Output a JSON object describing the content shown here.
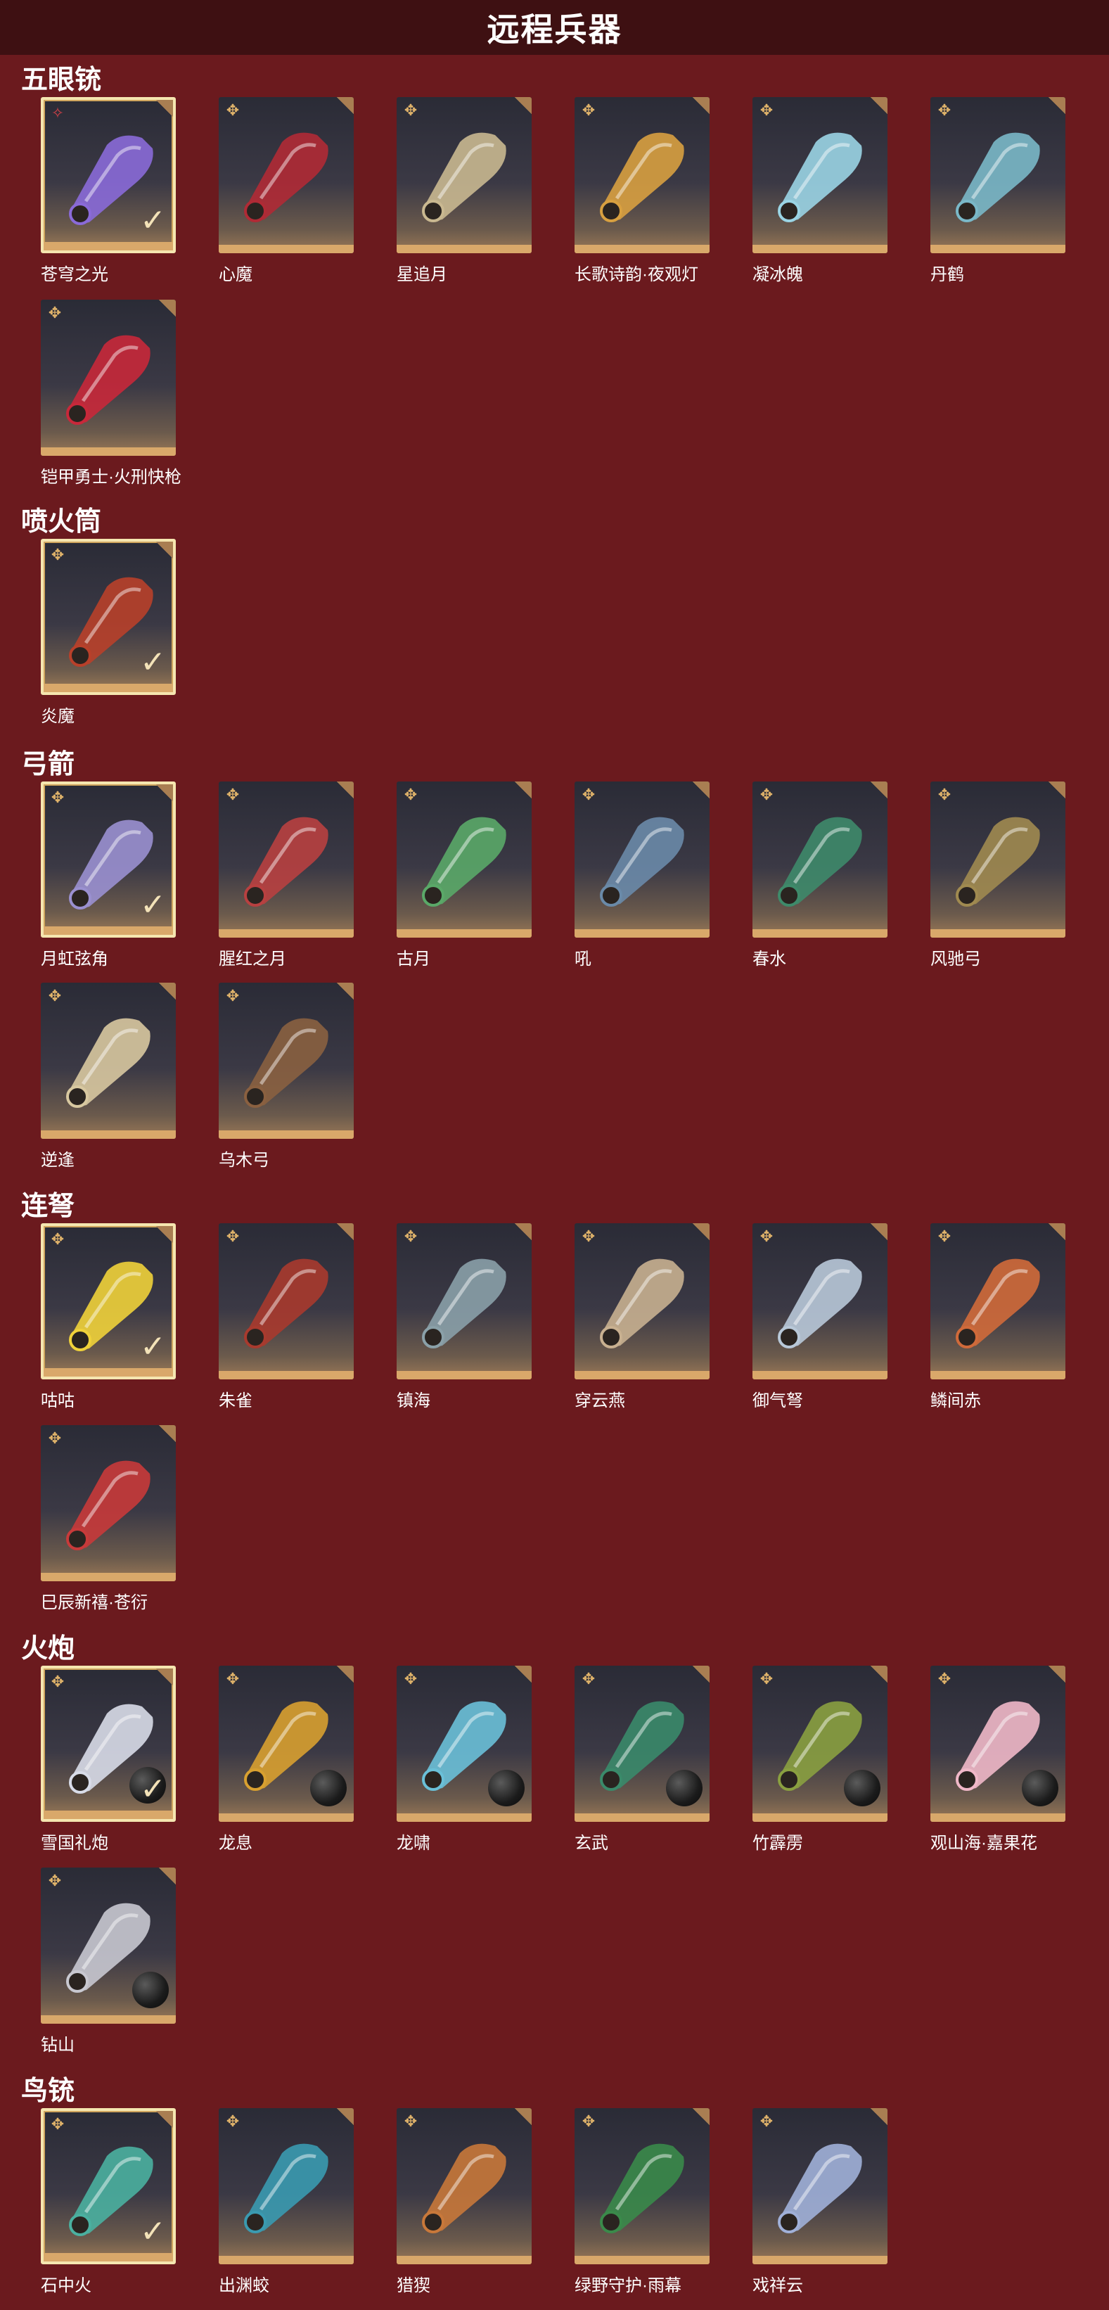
{
  "page": {
    "title": "远程兵器"
  },
  "sections": [
    {
      "title": "五眼铳",
      "items": [
        {
          "name": "苍穹之光",
          "selected": true,
          "rarity": "red",
          "color": "#8a6ad8"
        },
        {
          "name": "心魔",
          "selected": false,
          "color": "#b02a35"
        },
        {
          "name": "星追月",
          "selected": false,
          "color": "#c9b890"
        },
        {
          "name": "长歌诗韵·夜观灯",
          "selected": false,
          "color": "#d8a040"
        },
        {
          "name": "凝冰魄",
          "selected": false,
          "color": "#9ad4e4"
        },
        {
          "name": "丹鹤",
          "selected": false,
          "color": "#7ab8c8"
        },
        {
          "name": "铠甲勇士·火刑快枪",
          "selected": false,
          "color": "#c8283a"
        }
      ]
    },
    {
      "title": "喷火筒",
      "items": [
        {
          "name": "炎魔",
          "selected": true,
          "color": "#b8402a"
        }
      ]
    },
    {
      "title": "弓箭",
      "items": [
        {
          "name": "月虹弦角",
          "selected": true,
          "color": "#9a90d0"
        },
        {
          "name": "腥红之月",
          "selected": false,
          "color": "#b84040"
        },
        {
          "name": "古月",
          "selected": false,
          "color": "#5aa868"
        },
        {
          "name": "吼",
          "selected": false,
          "color": "#6a8aa8"
        },
        {
          "name": "春水",
          "selected": false,
          "color": "#3e8a6a"
        },
        {
          "name": "风驰弓",
          "selected": false,
          "color": "#a08a50"
        },
        {
          "name": "逆逢",
          "selected": false,
          "color": "#d8c8a0"
        },
        {
          "name": "乌木弓",
          "selected": false,
          "color": "#8a6040"
        }
      ]
    },
    {
      "title": "连弩",
      "items": [
        {
          "name": "咕咕",
          "selected": true,
          "color": "#f0d23a"
        },
        {
          "name": "朱雀",
          "selected": false,
          "color": "#a83a2e"
        },
        {
          "name": "镇海",
          "selected": false,
          "color": "#8aa0a8"
        },
        {
          "name": "穿云燕",
          "selected": false,
          "color": "#c8b090"
        },
        {
          "name": "御气弩",
          "selected": false,
          "color": "#b8c8d8"
        },
        {
          "name": "鳞间赤",
          "selected": false,
          "color": "#d06a3a"
        },
        {
          "name": "巳辰新禧·苍衍",
          "selected": false,
          "color": "#c83a3a"
        }
      ]
    },
    {
      "title": "火炮",
      "items": [
        {
          "name": "雪国礼炮",
          "selected": true,
          "ammo": true,
          "color": "#d8dce8"
        },
        {
          "name": "龙息",
          "selected": false,
          "ammo": true,
          "color": "#d8a030"
        },
        {
          "name": "龙啸",
          "selected": false,
          "ammo": true,
          "color": "#6ac0d8"
        },
        {
          "name": "玄武",
          "selected": false,
          "ammo": true,
          "color": "#3a8a6a"
        },
        {
          "name": "竹霹雳",
          "selected": false,
          "ammo": true,
          "color": "#8aa040"
        },
        {
          "name": "观山海·嘉果花",
          "selected": false,
          "ammo": true,
          "color": "#f0b8c8"
        },
        {
          "name": "钻山",
          "selected": false,
          "ammo": true,
          "color": "#c8c8d0"
        }
      ]
    },
    {
      "title": "鸟铳",
      "items": [
        {
          "name": "石中火",
          "selected": true,
          "color": "#4ab0a0"
        },
        {
          "name": "出渊蛟",
          "selected": false,
          "color": "#3a9ab0"
        },
        {
          "name": "猎猰",
          "selected": false,
          "color": "#c8783a"
        },
        {
          "name": "绿野守护·雨幕",
          "selected": false,
          "color": "#3a8a4a"
        },
        {
          "name": "戏祥云",
          "selected": false,
          "color": "#a0b0d8"
        }
      ]
    }
  ],
  "icons": {
    "rarity": "rarity-badge-icon",
    "check": "check-icon",
    "ammo": "cannonball-icon"
  }
}
